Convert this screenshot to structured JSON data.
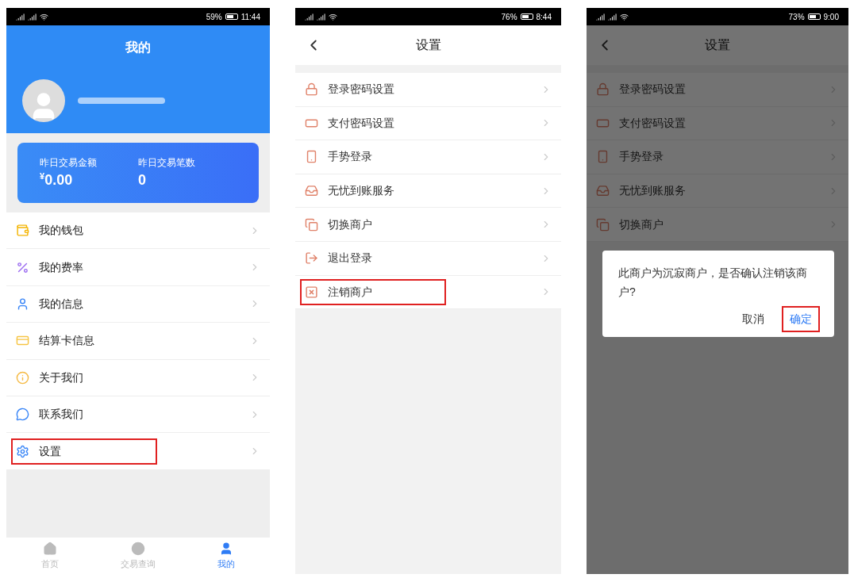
{
  "screens": [
    {
      "status_bar": {
        "battery": "59%",
        "time": "11:44"
      },
      "title": "我的",
      "stats": [
        {
          "label": "昨日交易金额",
          "currency": "¥",
          "value": "0.00"
        },
        {
          "label": "昨日交易笔数",
          "value": "0"
        }
      ],
      "menu": [
        {
          "label": "我的钱包",
          "highlighted": false
        },
        {
          "label": "我的费率",
          "highlighted": false
        },
        {
          "label": "我的信息",
          "highlighted": false
        },
        {
          "label": "结算卡信息",
          "highlighted": false
        },
        {
          "label": "关于我们",
          "highlighted": false
        },
        {
          "label": "联系我们",
          "highlighted": false
        },
        {
          "label": "设置",
          "highlighted": true
        }
      ],
      "tab_bar": [
        {
          "label": "首页",
          "selected": false
        },
        {
          "label": "交易查询",
          "selected": false
        },
        {
          "label": "我的",
          "selected": true
        }
      ]
    },
    {
      "status_bar": {
        "battery": "76%",
        "time": "8:44"
      },
      "title": "设置",
      "menu": [
        {
          "label": "登录密码设置",
          "highlighted": false
        },
        {
          "label": "支付密码设置",
          "highlighted": false
        },
        {
          "label": "手势登录",
          "highlighted": false
        },
        {
          "label": "无忧到账服务",
          "highlighted": false
        },
        {
          "label": "切换商户",
          "highlighted": false
        },
        {
          "label": "退出登录",
          "highlighted": false
        },
        {
          "label": "注销商户",
          "highlighted": true
        }
      ]
    },
    {
      "status_bar": {
        "battery": "73%",
        "time": "9:00"
      },
      "title": "设置",
      "menu": [
        {
          "label": "登录密码设置",
          "highlighted": false
        },
        {
          "label": "支付密码设置",
          "highlighted": false
        },
        {
          "label": "手势登录",
          "highlighted": false
        },
        {
          "label": "无忧到账服务",
          "highlighted": false
        },
        {
          "label": "切换商户",
          "highlighted": false
        }
      ],
      "dialog": {
        "message": "此商户为沉寂商户，是否确认注销该商户?",
        "buttons": [
          {
            "label": "取消",
            "highlighted": false
          },
          {
            "label": "确定",
            "highlighted": true
          }
        ]
      }
    }
  ]
}
